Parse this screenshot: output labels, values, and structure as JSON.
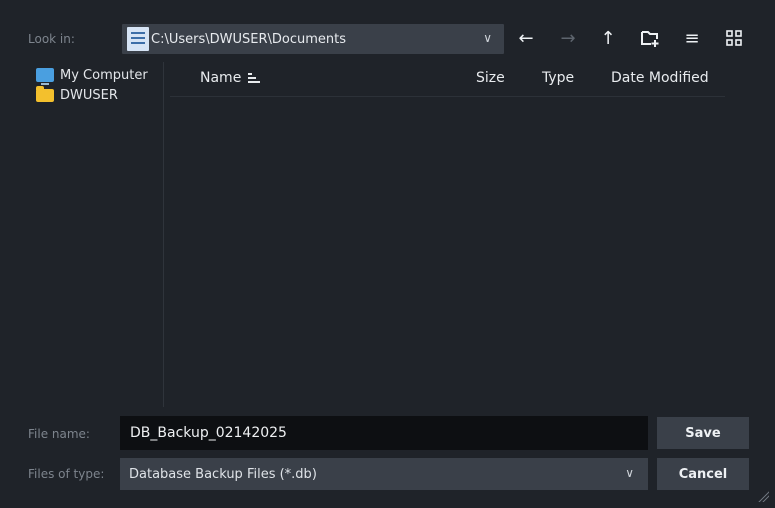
{
  "toolbar": {
    "look_in_label": "Look in:",
    "path": "C:\\Users\\DWUSER\\Documents",
    "icons": {
      "dropdown": "chevron-down-icon",
      "back": "arrow-left-icon",
      "forward": "arrow-right-icon",
      "up": "arrow-up-icon",
      "new_folder": "new-folder-icon",
      "list_view": "list-view-icon",
      "detail_view": "grid-view-icon"
    }
  },
  "sidebar": {
    "items": [
      {
        "label": "My Computer",
        "icon": "computer-icon"
      },
      {
        "label": "DWUSER",
        "icon": "folder-icon"
      }
    ]
  },
  "file_list": {
    "columns": [
      "Name",
      "Size",
      "Type",
      "Date Modified"
    ],
    "rows": []
  },
  "file_name": {
    "label": "File name:",
    "value": "DB_Backup_02142025"
  },
  "file_type": {
    "label": "Files of type:",
    "value": "Database Backup Files (*.db)"
  },
  "buttons": {
    "save": "Save",
    "cancel": "Cancel"
  },
  "colors": {
    "background": "#1f2329",
    "control": "#3a4049",
    "input": "#0d0f12",
    "accent_folder": "#f3c02d",
    "accent_computer": "#4a9fe0"
  }
}
